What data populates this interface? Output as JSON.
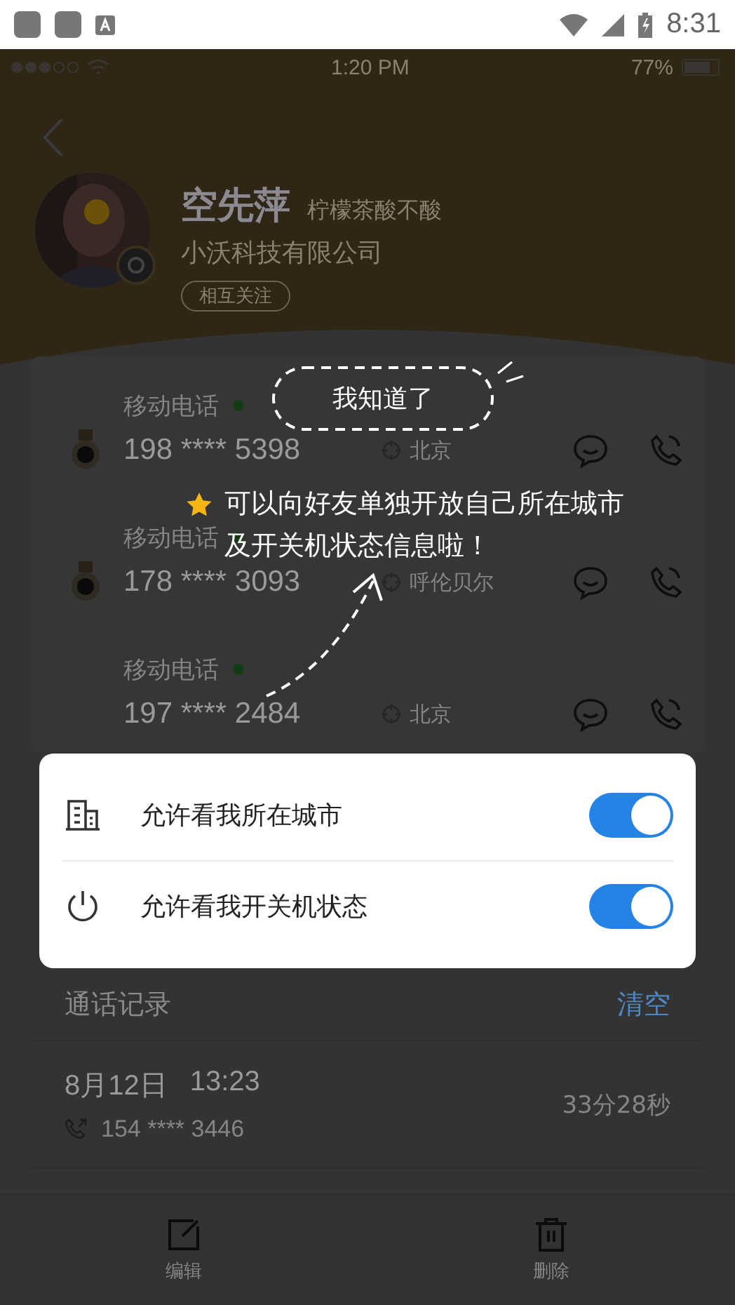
{
  "system_status": {
    "time": "8:31"
  },
  "app_status": {
    "time": "1:20 PM",
    "battery": "77%"
  },
  "profile": {
    "name": "空先萍",
    "signature": "柠檬茶酸不酸",
    "company": "小沃科技有限公司",
    "follow_badge": "相互关注"
  },
  "phones": [
    {
      "label": "移动电话",
      "online": true,
      "medal": true,
      "number": "198 **** 5398",
      "location": "北京"
    },
    {
      "label": "移动电话",
      "online": true,
      "medal": true,
      "number": "178 **** 3093",
      "location": "呼伦贝尔"
    },
    {
      "label": "移动电话",
      "online": true,
      "medal": false,
      "number": "197 **** 2484",
      "location": "北京"
    }
  ],
  "call_log": {
    "title": "通话记录",
    "clear": "清空",
    "entries": [
      {
        "date": "8月12日",
        "time": "13:23",
        "number": "154 **** 3446",
        "duration": "33分28秒"
      }
    ]
  },
  "toolbar": [
    {
      "label": "编辑",
      "kind": "edit"
    },
    {
      "label": "删除",
      "kind": "delete"
    }
  ],
  "privacy_popup": {
    "items": [
      {
        "label": "允许看我所在城市",
        "kind": "city",
        "on": true
      },
      {
        "label": "允许看我开关机状态",
        "kind": "power",
        "on": true
      }
    ]
  },
  "guide": {
    "dismiss": "我知道了",
    "message": "可以向好友单独开放自己所在城市及开关机状态信息啦！"
  }
}
